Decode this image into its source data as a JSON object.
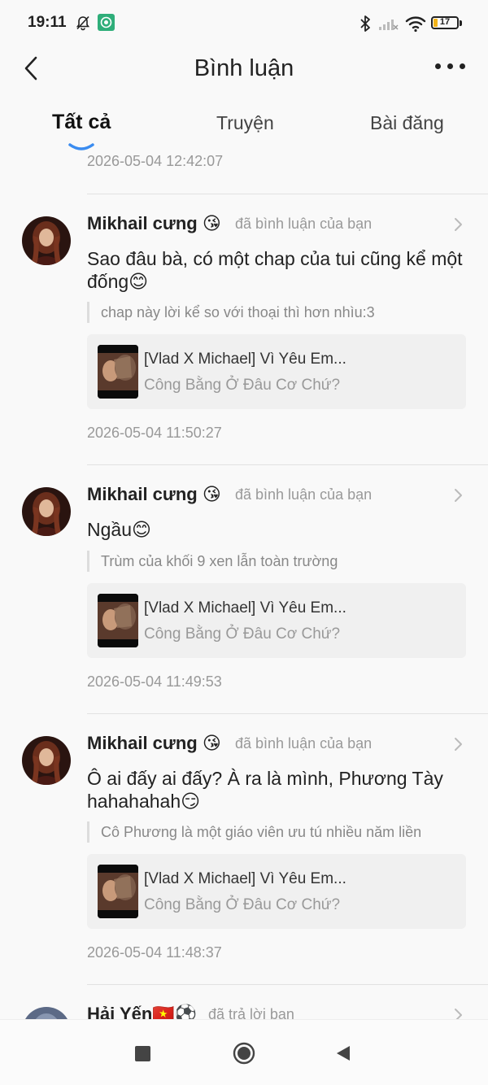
{
  "status_bar": {
    "time": "19:11",
    "battery": "17",
    "icons": [
      "bell-off-icon",
      "app-notification-icon",
      "bluetooth-icon",
      "signal-icon",
      "wifi-icon",
      "battery-icon"
    ]
  },
  "header": {
    "title": "Bình luận",
    "back_icon": "chevron-left-icon",
    "more_icon": "more-horizontal-icon"
  },
  "tabs": [
    {
      "label": "Tất cả",
      "active": true
    },
    {
      "label": "Truyện",
      "active": false
    },
    {
      "label": "Bài đăng",
      "active": false
    }
  ],
  "feed": {
    "previous_timestamp": "2026-05-04 12:42:07",
    "items": [
      {
        "username": "Mikhail cưng 😘",
        "action": "đã bình luận của bạn",
        "comment": "Sao đâu bà, có một chap của tui cũng kể một đống😊",
        "quote": "chap này lời kể so với thoại thì hơn nhìu:3",
        "story_title": "[Vlad X Michael] Vì Yêu Em...",
        "story_subtitle": "Công Bằng Ở Đâu Cơ Chứ?",
        "timestamp": "2026-05-04 11:50:27"
      },
      {
        "username": "Mikhail cưng 😘",
        "action": "đã bình luận của bạn",
        "comment": "Ngầu😊",
        "quote": "Trùm của khối 9 xen lẫn toàn  trường",
        "story_title": "[Vlad X Michael] Vì Yêu Em...",
        "story_subtitle": "Công Bằng Ở Đâu Cơ Chứ?",
        "timestamp": "2026-05-04 11:49:53"
      },
      {
        "username": "Mikhail cưng 😘",
        "action": "đã bình luận của bạn",
        "comment": "Ô ai đấy ai đấy? À ra là mình, Phương Tày hahahahah😏",
        "quote": "Cô Phương là một giáo viên ưu tú nhiều năm liền",
        "story_title": "[Vlad X Michael] Vì Yêu Em...",
        "story_subtitle": "Công Bằng Ở Đâu Cơ Chứ?",
        "timestamp": "2026-05-04 11:48:37"
      },
      {
        "username": "Hải Yến🇻🇳⚽",
        "action": "đã trả lời bạn"
      }
    ]
  },
  "nav_bar": {
    "icons": [
      "recent-apps-icon",
      "home-icon",
      "back-icon"
    ]
  },
  "colors": {
    "background": "#f9f9f9",
    "tab_indicator": "#3b8cf0",
    "card_background": "#f0f0f0",
    "muted_text": "#999999"
  }
}
